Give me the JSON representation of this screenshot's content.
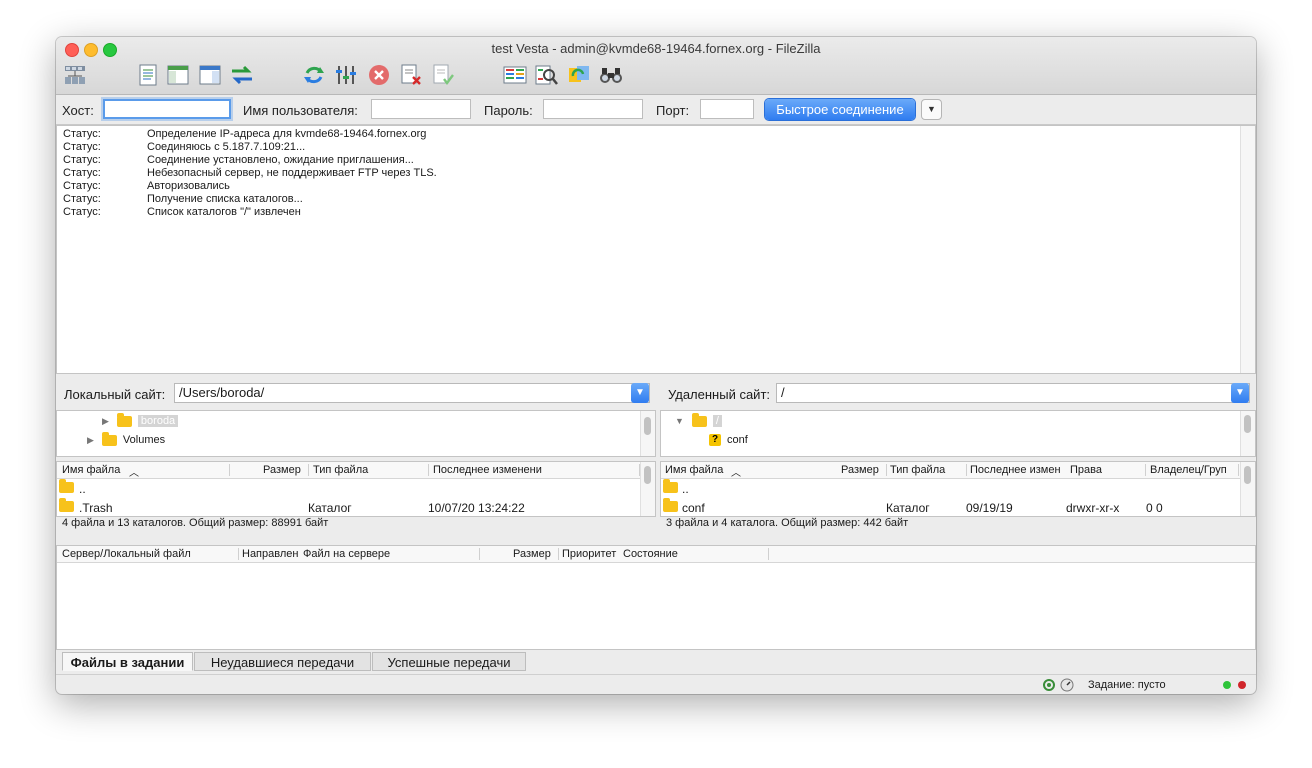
{
  "window": {
    "title": "test Vesta - admin@kvmde68-19464.fornex.org - FileZilla"
  },
  "toolbar": {
    "icons": [
      "site-manager-icon",
      "message-log-icon",
      "local-tree-icon",
      "remote-tree-icon",
      "transfer-queue-icon",
      "refresh-icon",
      "process-queue-icon",
      "cancel-icon",
      "disconnect-icon",
      "reconnect-icon",
      "directory-comparison-icon",
      "filter-icon",
      "sync-browsing-icon",
      "search-icon"
    ]
  },
  "quickconnect": {
    "host_label": "Хост:",
    "host_value": "",
    "user_label": "Имя пользователя:",
    "user_value": "",
    "pass_label": "Пароль:",
    "pass_value": "",
    "port_label": "Порт:",
    "port_value": "",
    "connect_button": "Быстрое соединение",
    "dropdown_glyph": "▼"
  },
  "log": [
    {
      "key": "Статус:",
      "message": "Определение IP-адреса для kvmde68-19464.fornex.org"
    },
    {
      "key": "Статус:",
      "message": "Соединяюсь с 5.187.7.109:21..."
    },
    {
      "key": "Статус:",
      "message": "Соединение установлено, ожидание приглашения..."
    },
    {
      "key": "Статус:",
      "message": "Небезопасный сервер, не поддерживает FTP через TLS."
    },
    {
      "key": "Статус:",
      "message": "Авторизовались"
    },
    {
      "key": "Статус:",
      "message": "Получение списка каталогов..."
    },
    {
      "key": "Статус:",
      "message": "Список каталогов \"/\" извлечен"
    }
  ],
  "local": {
    "site_label": "Локальный сайт:",
    "path": "/Users/boroda/",
    "tree": [
      {
        "name": "boroda",
        "selected": true
      },
      {
        "name": "Volumes",
        "selected": false
      }
    ],
    "columns": [
      "Имя файла",
      "Размер",
      "Тип файла",
      "Последнее изменени"
    ],
    "rows": [
      {
        "name": "..",
        "size": "",
        "type": "",
        "modified": ""
      },
      {
        "name": ".Trash",
        "size": "",
        "type": "Каталог",
        "modified": "10/07/20 13:24:22"
      }
    ],
    "status": "4 файла и 13 каталогов. Общий размер: 88991 байт"
  },
  "remote": {
    "site_label": "Удаленный сайт:",
    "path": "/",
    "tree": [
      {
        "name": "/",
        "selected": true
      },
      {
        "name": "conf",
        "selected": false
      }
    ],
    "columns": [
      "Имя файла",
      "Размер",
      "Тип файла",
      "Последнее измен",
      "Права",
      "Владелец/Груп"
    ],
    "rows": [
      {
        "name": "..",
        "size": "",
        "type": "",
        "modified": "",
        "perms": "",
        "owner": ""
      },
      {
        "name": "conf",
        "size": "",
        "type": "Каталог",
        "modified": "09/19/19",
        "perms": "drwxr-xr-x",
        "owner": "0 0"
      }
    ],
    "status": "3 файла и 4 каталога. Общий размер: 442 байт"
  },
  "queue": {
    "columns": [
      "Сервер/Локальный файл",
      "Направлен",
      "Файл на сервере",
      "Размер",
      "Приоритет",
      "Состояние"
    ],
    "tabs": [
      "Файлы в задании",
      "Неудавшиеся передачи",
      "Успешные передачи"
    ]
  },
  "statusbar": {
    "queue_text": "Задание: пусто"
  },
  "colors": {
    "accent": "#2f7cf0",
    "folder": "#f7c21b",
    "led_green": "#2ec43a",
    "led_red": "#d0262b"
  }
}
